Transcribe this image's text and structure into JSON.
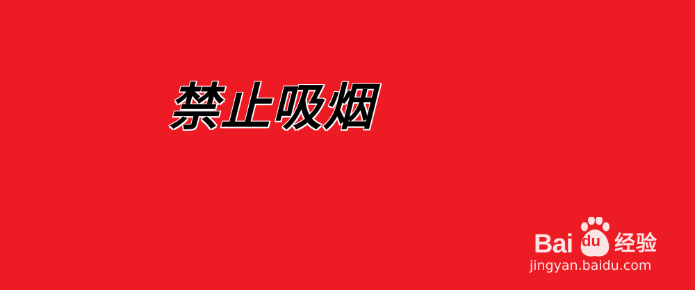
{
  "background_color": "#ED1C24",
  "sign": {
    "text": "禁止吸烟",
    "text_color": "#000000",
    "outline_color": "#FFFFFF"
  },
  "watermark": {
    "brand_latin_left": "Bai",
    "brand_latin_right": "du",
    "brand_chinese": "经验",
    "url": "jingyan.baidu.com",
    "logo_icon": "baidu-paw-icon",
    "color": "#FFFFFF"
  }
}
